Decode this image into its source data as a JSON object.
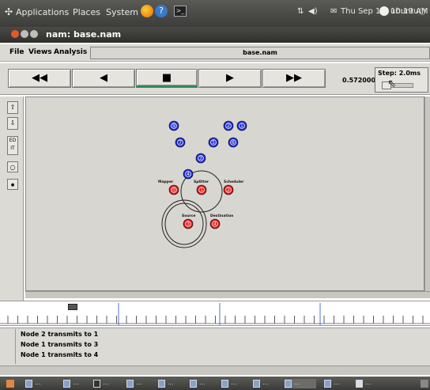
{
  "system_panel": {
    "menus": [
      "Applications",
      "Places",
      "System"
    ],
    "datetime": "Thu Sep 11, 10:19 AM",
    "user": "ubuntu"
  },
  "window": {
    "title": "nam: base.nam"
  },
  "menubar": {
    "items": [
      "File",
      "Views",
      "Analysis"
    ],
    "filename": "base.nam"
  },
  "toolbar": {
    "rewind": "◀◀",
    "back": "◀",
    "stop": "■",
    "play": "▶",
    "fast_forward": "▶▶",
    "time": "0.572000",
    "step": "Step: 2.0ms"
  },
  "left_tools": {
    "edit": "ED\nIT"
  },
  "nodes": [
    {
      "id": "9",
      "color": "blue"
    },
    {
      "id": "7",
      "color": "blue"
    },
    {
      "id": "2",
      "color": "blue"
    },
    {
      "id": "1",
      "color": "blue"
    },
    {
      "id": "5",
      "color": "blue"
    },
    {
      "id": "6",
      "color": "blue"
    },
    {
      "id": "3",
      "color": "blue"
    },
    {
      "id": "4",
      "color": "blue"
    },
    {
      "id": "0",
      "color": "red",
      "label": "Mapper"
    },
    {
      "id": "1",
      "color": "red",
      "label": "Splitter"
    },
    {
      "id": "2",
      "color": "red",
      "label": "Scheduler"
    },
    {
      "id": "3",
      "color": "red",
      "label": "Source"
    },
    {
      "id": "4",
      "color": "red",
      "label": "Destination"
    }
  ],
  "timeline": {
    "marker_label": ""
  },
  "annotations": [
    "Node 2 transmits to 1",
    "Node 1 transmits to 3",
    "Node 1 transmits to 4"
  ],
  "colors": {
    "node_blue": "#1e2fd6",
    "node_red": "#e01818",
    "canvas_bg": "#d8d6d1"
  }
}
